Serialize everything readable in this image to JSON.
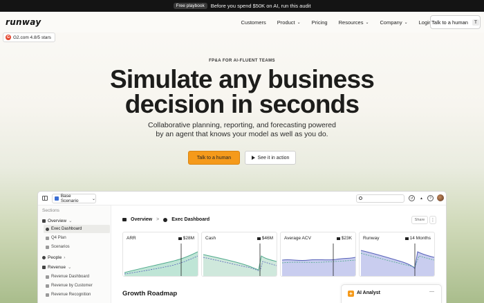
{
  "promo": {
    "pill": "Free playbook",
    "text": "Before you spend $50K on AI, run this audit"
  },
  "header": {
    "logo": "runway",
    "nav": [
      {
        "label": "Customers",
        "dropdown": false
      },
      {
        "label": "Product",
        "dropdown": true
      },
      {
        "label": "Pricing",
        "dropdown": false
      },
      {
        "label": "Resources",
        "dropdown": true
      },
      {
        "label": "Company",
        "dropdown": true
      },
      {
        "label": "Login",
        "dropdown": false
      }
    ],
    "talk_button": "Talk to a human",
    "talk_shortcut": "T"
  },
  "badge": {
    "icon": "G",
    "text": "G2.com 4.8/5 stars"
  },
  "hero": {
    "eyebrow": "FP&A FOR AI-FLUENT TEAMS",
    "title_line1": "Simulate any business",
    "title_line2": "decision in seconds",
    "subtitle_line1": "Collaborative planning, reporting, and forecasting powered",
    "subtitle_line2": "by an agent that knows your model as well as you do.",
    "cta_primary": "Talk to a human",
    "cta_secondary": "See it in action"
  },
  "app": {
    "scenario": "Base Scenario",
    "sidebar": {
      "heading": "Sections",
      "items": [
        {
          "label": "Overview",
          "caret": "⌄"
        },
        {
          "label": "Exec Dashboard"
        },
        {
          "label": "Q4 Plan"
        },
        {
          "label": "Scenarios"
        },
        {
          "label": "People",
          "caret": "›"
        },
        {
          "label": "Revenue",
          "caret": "⌄"
        },
        {
          "label": "Revenue Dashboard"
        },
        {
          "label": "Revenue by Customer"
        },
        {
          "label": "Revenue Recognition"
        }
      ]
    },
    "breadcrumb": {
      "first": "Overview",
      "sep": ">",
      "second": "Exec Dashboard"
    },
    "share": "Share",
    "more": "⋮",
    "cards": [
      {
        "label": "ARR",
        "value": "$28M"
      },
      {
        "label": "Cash",
        "value": "$46M"
      },
      {
        "label": "Average ACV",
        "value": "$23K"
      },
      {
        "label": "Runway",
        "value": "14 Months"
      }
    ],
    "section_title": "Growth Roadmap",
    "ai_panel": {
      "title": "AI Analyst",
      "min": "—"
    }
  },
  "colors": {
    "accent": "#f59a1b",
    "chart_green": "#5fb9a0",
    "chart_blue": "#6672c9"
  }
}
